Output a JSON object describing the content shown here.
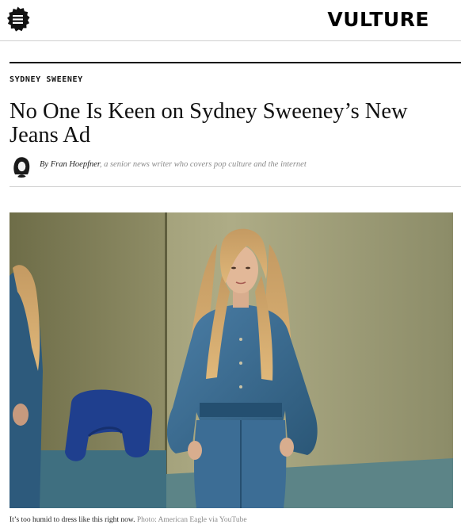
{
  "header": {
    "menu_icon": "hamburger-badge-icon",
    "logo_text": "VULTURE"
  },
  "article": {
    "kicker": "SYDNEY SWEENEY",
    "headline": "No One Is Keen on Sydney Sweeney’s New Jeans Ad",
    "byline": {
      "prefix": "By ",
      "author": "Fran Hoepfner",
      "description": ", a senior news writer who covers pop culture and the internet"
    },
    "image": {
      "caption": "It’s too humid to dress like this right now.",
      "credit": "Photo: American Eagle via YouTube"
    }
  },
  "colors": {
    "text": "#111111",
    "muted": "#8a8a8a",
    "rule": "#cfcfcf",
    "denim": "#2f5f86",
    "wall": "#a7a680"
  }
}
